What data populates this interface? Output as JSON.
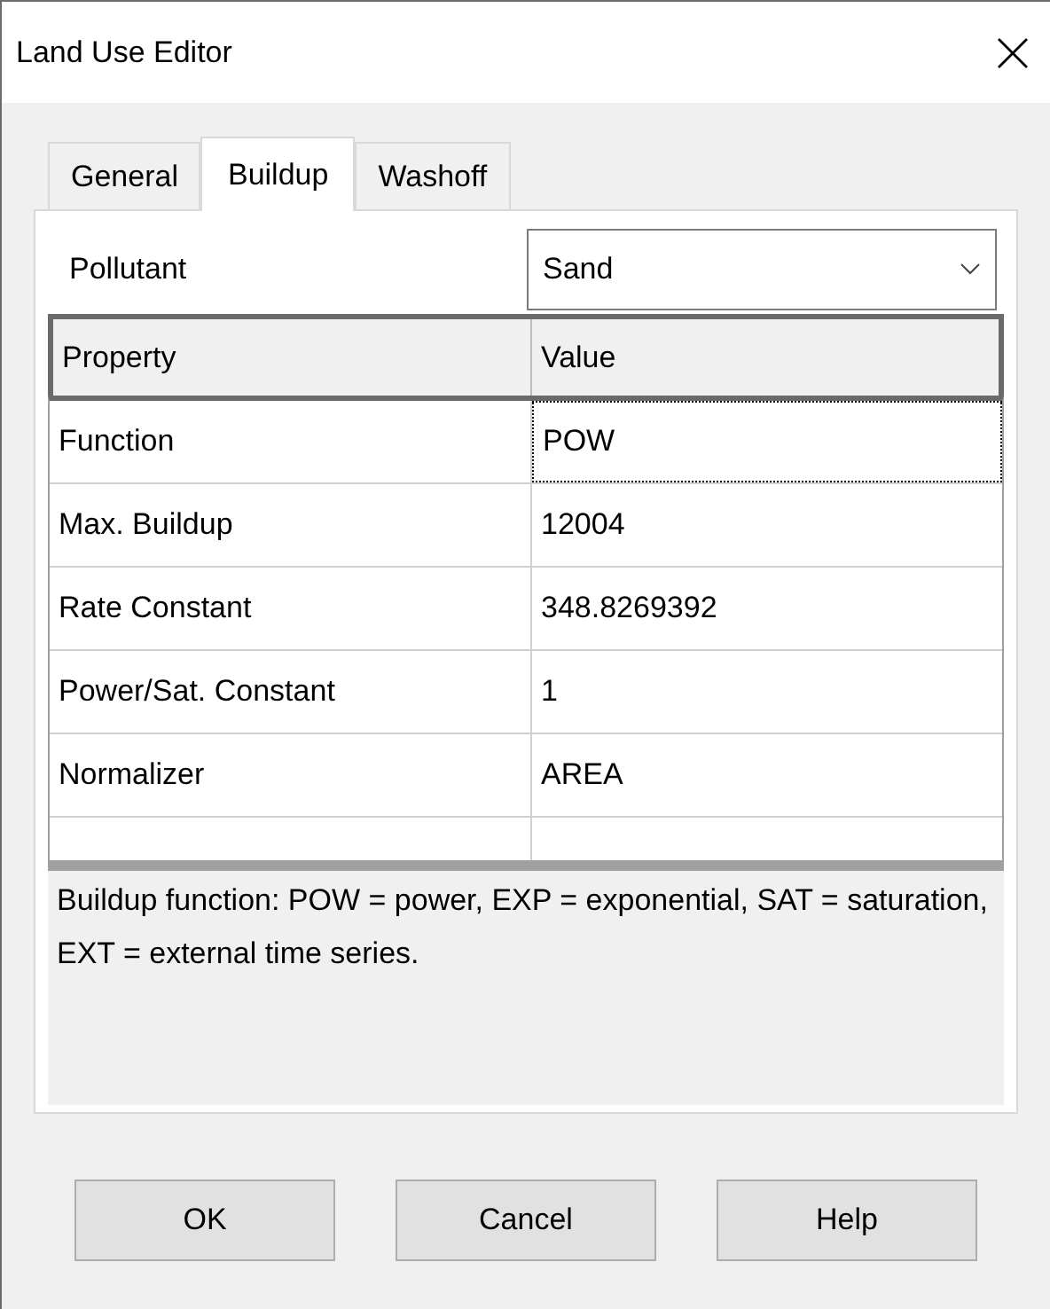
{
  "window": {
    "title": "Land Use Editor"
  },
  "tabs": [
    {
      "label": "General",
      "selected": false
    },
    {
      "label": "Buildup",
      "selected": true
    },
    {
      "label": "Washoff",
      "selected": false
    }
  ],
  "pollutant": {
    "label": "Pollutant",
    "value": "Sand"
  },
  "table": {
    "columns": [
      "Property",
      "Value"
    ],
    "rows": [
      {
        "property": "Function",
        "value": "POW",
        "focused": true
      },
      {
        "property": "Max. Buildup",
        "value": "12004",
        "focused": false
      },
      {
        "property": "Rate Constant",
        "value": "348.8269392",
        "focused": false
      },
      {
        "property": "Power/Sat. Constant",
        "value": "1",
        "focused": false
      },
      {
        "property": "Normalizer",
        "value": "AREA",
        "focused": false
      }
    ]
  },
  "description": "Buildup function: POW = power, EXP = exponential, SAT = saturation, EXT = external time series.",
  "buttons": [
    "OK",
    "Cancel",
    "Help"
  ]
}
